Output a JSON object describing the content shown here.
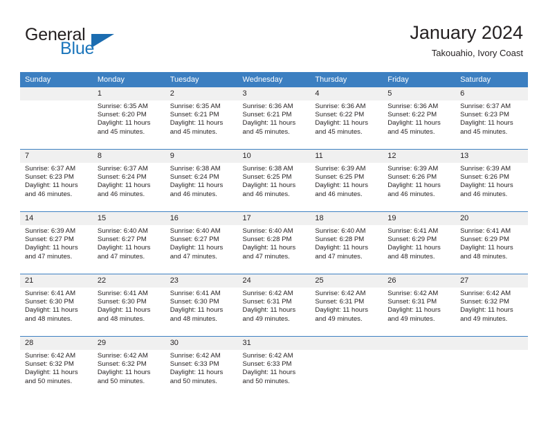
{
  "brand": {
    "name_part1": "General",
    "name_part2": "Blue",
    "triangle_icon": "triangle-icon",
    "accent_color": "#1b75bb"
  },
  "header": {
    "title": "January 2024",
    "subtitle": "Takouahio, Ivory Coast"
  },
  "theme": {
    "header_row_bg": "#3c7fc1",
    "daynum_bg": "#f0f0f0",
    "text_color": "#231f20",
    "page_bg": "#ffffff"
  },
  "weekday_headers": [
    "Sunday",
    "Monday",
    "Tuesday",
    "Wednesday",
    "Thursday",
    "Friday",
    "Saturday"
  ],
  "weeks": [
    [
      {
        "day": "",
        "empty": true,
        "sunrise": "",
        "sunset": "",
        "daylight1": "",
        "daylight2": ""
      },
      {
        "day": "1",
        "empty": false,
        "sunrise": "Sunrise: 6:35 AM",
        "sunset": "Sunset: 6:20 PM",
        "daylight1": "Daylight: 11 hours",
        "daylight2": "and 45 minutes."
      },
      {
        "day": "2",
        "empty": false,
        "sunrise": "Sunrise: 6:35 AM",
        "sunset": "Sunset: 6:21 PM",
        "daylight1": "Daylight: 11 hours",
        "daylight2": "and 45 minutes."
      },
      {
        "day": "3",
        "empty": false,
        "sunrise": "Sunrise: 6:36 AM",
        "sunset": "Sunset: 6:21 PM",
        "daylight1": "Daylight: 11 hours",
        "daylight2": "and 45 minutes."
      },
      {
        "day": "4",
        "empty": false,
        "sunrise": "Sunrise: 6:36 AM",
        "sunset": "Sunset: 6:22 PM",
        "daylight1": "Daylight: 11 hours",
        "daylight2": "and 45 minutes."
      },
      {
        "day": "5",
        "empty": false,
        "sunrise": "Sunrise: 6:36 AM",
        "sunset": "Sunset: 6:22 PM",
        "daylight1": "Daylight: 11 hours",
        "daylight2": "and 45 minutes."
      },
      {
        "day": "6",
        "empty": false,
        "sunrise": "Sunrise: 6:37 AM",
        "sunset": "Sunset: 6:23 PM",
        "daylight1": "Daylight: 11 hours",
        "daylight2": "and 45 minutes."
      }
    ],
    [
      {
        "day": "7",
        "empty": false,
        "sunrise": "Sunrise: 6:37 AM",
        "sunset": "Sunset: 6:23 PM",
        "daylight1": "Daylight: 11 hours",
        "daylight2": "and 46 minutes."
      },
      {
        "day": "8",
        "empty": false,
        "sunrise": "Sunrise: 6:37 AM",
        "sunset": "Sunset: 6:24 PM",
        "daylight1": "Daylight: 11 hours",
        "daylight2": "and 46 minutes."
      },
      {
        "day": "9",
        "empty": false,
        "sunrise": "Sunrise: 6:38 AM",
        "sunset": "Sunset: 6:24 PM",
        "daylight1": "Daylight: 11 hours",
        "daylight2": "and 46 minutes."
      },
      {
        "day": "10",
        "empty": false,
        "sunrise": "Sunrise: 6:38 AM",
        "sunset": "Sunset: 6:25 PM",
        "daylight1": "Daylight: 11 hours",
        "daylight2": "and 46 minutes."
      },
      {
        "day": "11",
        "empty": false,
        "sunrise": "Sunrise: 6:39 AM",
        "sunset": "Sunset: 6:25 PM",
        "daylight1": "Daylight: 11 hours",
        "daylight2": "and 46 minutes."
      },
      {
        "day": "12",
        "empty": false,
        "sunrise": "Sunrise: 6:39 AM",
        "sunset": "Sunset: 6:26 PM",
        "daylight1": "Daylight: 11 hours",
        "daylight2": "and 46 minutes."
      },
      {
        "day": "13",
        "empty": false,
        "sunrise": "Sunrise: 6:39 AM",
        "sunset": "Sunset: 6:26 PM",
        "daylight1": "Daylight: 11 hours",
        "daylight2": "and 46 minutes."
      }
    ],
    [
      {
        "day": "14",
        "empty": false,
        "sunrise": "Sunrise: 6:39 AM",
        "sunset": "Sunset: 6:27 PM",
        "daylight1": "Daylight: 11 hours",
        "daylight2": "and 47 minutes."
      },
      {
        "day": "15",
        "empty": false,
        "sunrise": "Sunrise: 6:40 AM",
        "sunset": "Sunset: 6:27 PM",
        "daylight1": "Daylight: 11 hours",
        "daylight2": "and 47 minutes."
      },
      {
        "day": "16",
        "empty": false,
        "sunrise": "Sunrise: 6:40 AM",
        "sunset": "Sunset: 6:27 PM",
        "daylight1": "Daylight: 11 hours",
        "daylight2": "and 47 minutes."
      },
      {
        "day": "17",
        "empty": false,
        "sunrise": "Sunrise: 6:40 AM",
        "sunset": "Sunset: 6:28 PM",
        "daylight1": "Daylight: 11 hours",
        "daylight2": "and 47 minutes."
      },
      {
        "day": "18",
        "empty": false,
        "sunrise": "Sunrise: 6:40 AM",
        "sunset": "Sunset: 6:28 PM",
        "daylight1": "Daylight: 11 hours",
        "daylight2": "and 47 minutes."
      },
      {
        "day": "19",
        "empty": false,
        "sunrise": "Sunrise: 6:41 AM",
        "sunset": "Sunset: 6:29 PM",
        "daylight1": "Daylight: 11 hours",
        "daylight2": "and 48 minutes."
      },
      {
        "day": "20",
        "empty": false,
        "sunrise": "Sunrise: 6:41 AM",
        "sunset": "Sunset: 6:29 PM",
        "daylight1": "Daylight: 11 hours",
        "daylight2": "and 48 minutes."
      }
    ],
    [
      {
        "day": "21",
        "empty": false,
        "sunrise": "Sunrise: 6:41 AM",
        "sunset": "Sunset: 6:30 PM",
        "daylight1": "Daylight: 11 hours",
        "daylight2": "and 48 minutes."
      },
      {
        "day": "22",
        "empty": false,
        "sunrise": "Sunrise: 6:41 AM",
        "sunset": "Sunset: 6:30 PM",
        "daylight1": "Daylight: 11 hours",
        "daylight2": "and 48 minutes."
      },
      {
        "day": "23",
        "empty": false,
        "sunrise": "Sunrise: 6:41 AM",
        "sunset": "Sunset: 6:30 PM",
        "daylight1": "Daylight: 11 hours",
        "daylight2": "and 48 minutes."
      },
      {
        "day": "24",
        "empty": false,
        "sunrise": "Sunrise: 6:42 AM",
        "sunset": "Sunset: 6:31 PM",
        "daylight1": "Daylight: 11 hours",
        "daylight2": "and 49 minutes."
      },
      {
        "day": "25",
        "empty": false,
        "sunrise": "Sunrise: 6:42 AM",
        "sunset": "Sunset: 6:31 PM",
        "daylight1": "Daylight: 11 hours",
        "daylight2": "and 49 minutes."
      },
      {
        "day": "26",
        "empty": false,
        "sunrise": "Sunrise: 6:42 AM",
        "sunset": "Sunset: 6:31 PM",
        "daylight1": "Daylight: 11 hours",
        "daylight2": "and 49 minutes."
      },
      {
        "day": "27",
        "empty": false,
        "sunrise": "Sunrise: 6:42 AM",
        "sunset": "Sunset: 6:32 PM",
        "daylight1": "Daylight: 11 hours",
        "daylight2": "and 49 minutes."
      }
    ],
    [
      {
        "day": "28",
        "empty": false,
        "sunrise": "Sunrise: 6:42 AM",
        "sunset": "Sunset: 6:32 PM",
        "daylight1": "Daylight: 11 hours",
        "daylight2": "and 50 minutes."
      },
      {
        "day": "29",
        "empty": false,
        "sunrise": "Sunrise: 6:42 AM",
        "sunset": "Sunset: 6:32 PM",
        "daylight1": "Daylight: 11 hours",
        "daylight2": "and 50 minutes."
      },
      {
        "day": "30",
        "empty": false,
        "sunrise": "Sunrise: 6:42 AM",
        "sunset": "Sunset: 6:33 PM",
        "daylight1": "Daylight: 11 hours",
        "daylight2": "and 50 minutes."
      },
      {
        "day": "31",
        "empty": false,
        "sunrise": "Sunrise: 6:42 AM",
        "sunset": "Sunset: 6:33 PM",
        "daylight1": "Daylight: 11 hours",
        "daylight2": "and 50 minutes."
      },
      {
        "day": "",
        "empty": true,
        "sunrise": "",
        "sunset": "",
        "daylight1": "",
        "daylight2": ""
      },
      {
        "day": "",
        "empty": true,
        "sunrise": "",
        "sunset": "",
        "daylight1": "",
        "daylight2": ""
      },
      {
        "day": "",
        "empty": true,
        "sunrise": "",
        "sunset": "",
        "daylight1": "",
        "daylight2": ""
      }
    ]
  ]
}
